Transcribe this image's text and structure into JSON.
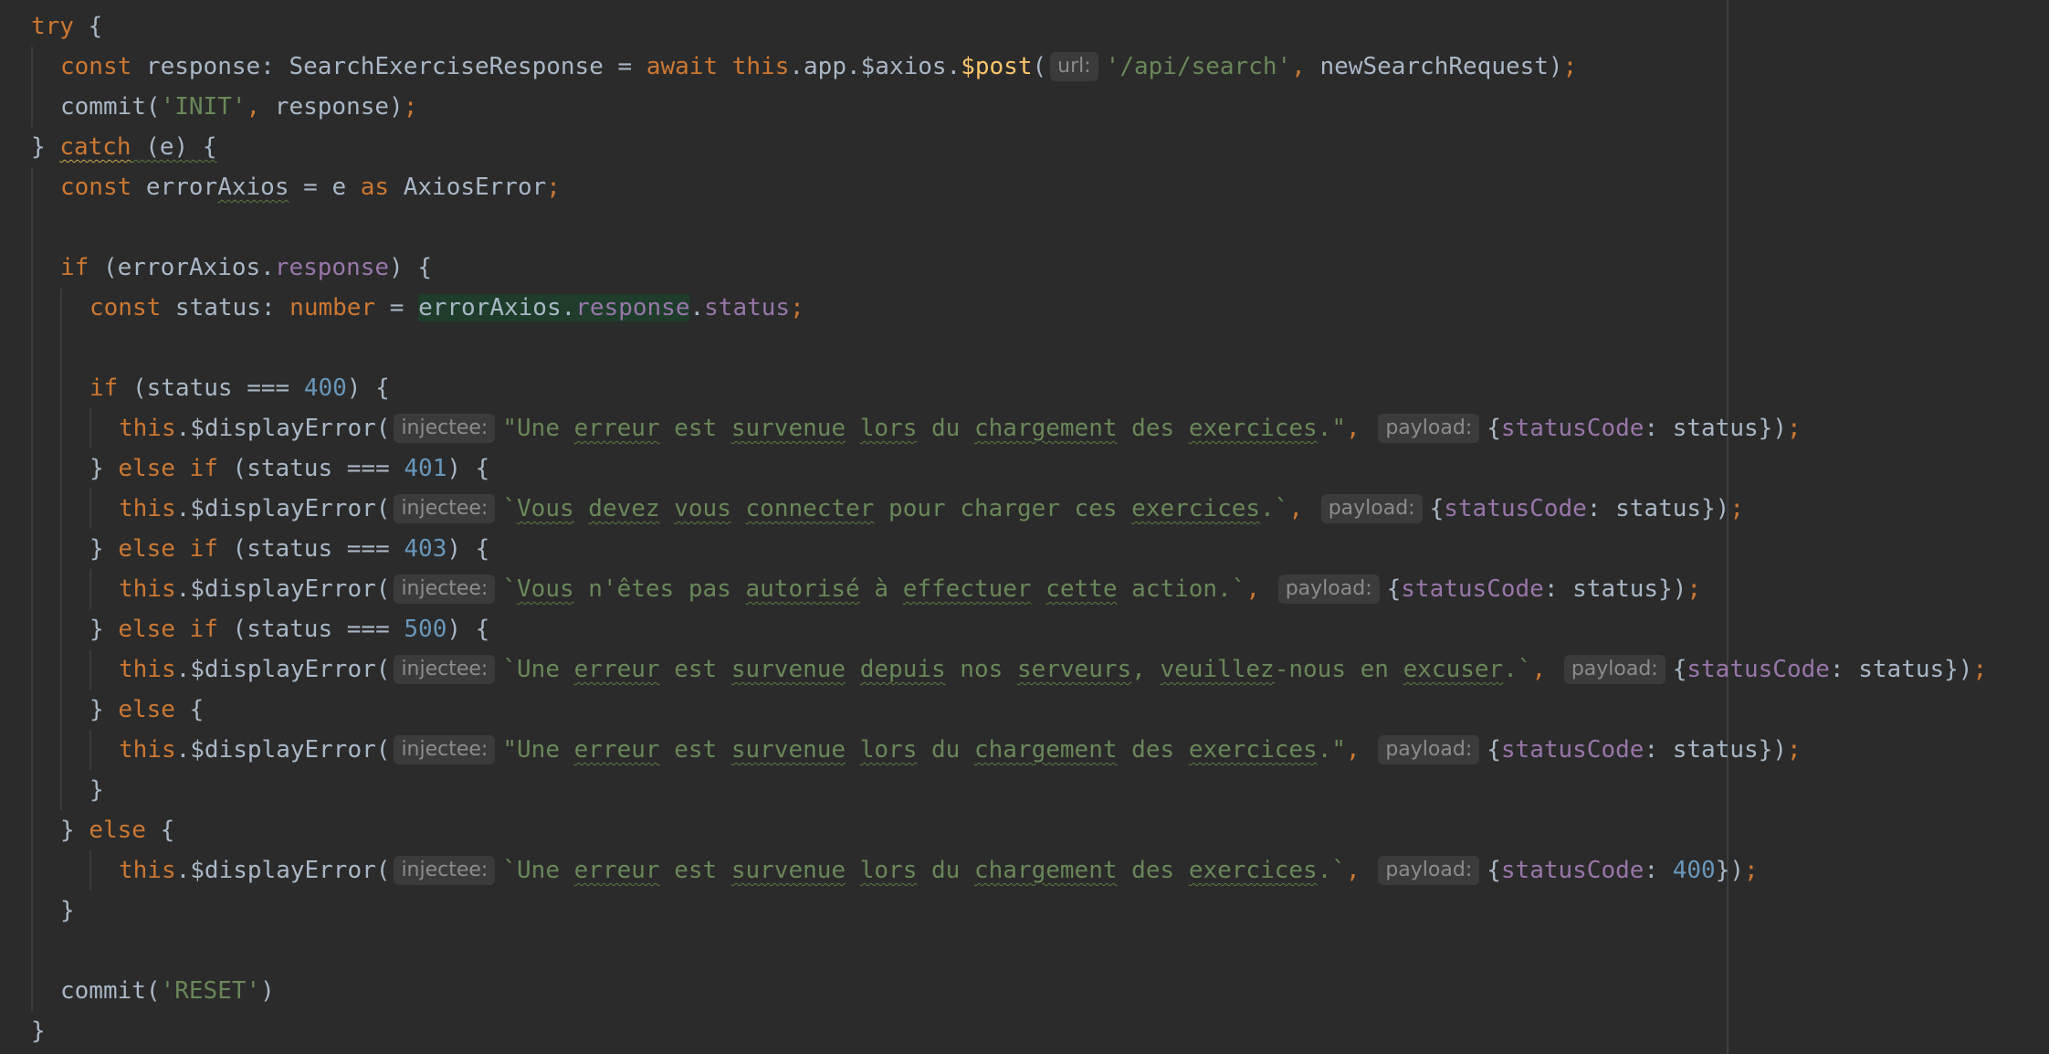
{
  "editor": {
    "language": "TypeScript",
    "colors": {
      "background": "#2b2b2b",
      "keyword": "#cc7832",
      "string": "#6a8759",
      "number": "#6897bb",
      "property": "#9876aa",
      "function": "#ffc66d",
      "text": "#a9b7c6",
      "hint_bg": "#3b3b3b",
      "hint_text": "#8c8c8c",
      "highlight": "#1f3d2b"
    },
    "lines": [
      [
        [
          "kw",
          "try"
        ],
        [
          "plain",
          " {"
        ]
      ],
      [
        [
          "kw",
          "const"
        ],
        [
          "plain",
          " response: SearchExerciseResponse = "
        ],
        [
          "kw",
          "await"
        ],
        [
          "plain",
          " "
        ],
        [
          "kw",
          "this"
        ],
        [
          "plain",
          ".app.$axios."
        ],
        [
          "fn",
          "$post"
        ],
        [
          "plain",
          "("
        ],
        [
          "hint",
          "url:"
        ],
        [
          "str",
          "'/api/search'"
        ],
        [
          "punct",
          ","
        ],
        [
          "plain",
          " newSearchRequest)"
        ],
        [
          "punct",
          ";"
        ]
      ],
      [
        [
          "plain",
          "commit("
        ],
        [
          "str",
          "'INIT'"
        ],
        [
          "punct",
          ","
        ],
        [
          "plain",
          " response)"
        ],
        [
          "punct",
          ";"
        ]
      ],
      [
        [
          "plain",
          "} "
        ],
        [
          "kwtypo",
          "catch"
        ],
        [
          "plaintypo",
          " (e) {"
        ]
      ],
      [
        [
          "kw",
          "const"
        ],
        [
          "plain",
          " error"
        ],
        [
          "plaintypo",
          "Axios"
        ],
        [
          "plain",
          " = e "
        ],
        [
          "kw",
          "as"
        ],
        [
          "plain",
          " AxiosError"
        ],
        [
          "punct",
          ";"
        ]
      ],
      [],
      [
        [
          "kw",
          "if"
        ],
        [
          "plain",
          " (errorAxios."
        ],
        [
          "prop",
          "response"
        ],
        [
          "plain",
          ") {"
        ]
      ],
      [
        [
          "kw",
          "const"
        ],
        [
          "plain",
          " status: "
        ],
        [
          "kw",
          "number"
        ],
        [
          "plain",
          " = "
        ],
        [
          "hlplain",
          "errorAxios."
        ],
        [
          "hlprop",
          "response"
        ],
        [
          "plain",
          "."
        ],
        [
          "prop",
          "status"
        ],
        [
          "punct",
          ";"
        ]
      ],
      [],
      [
        [
          "kw",
          "if"
        ],
        [
          "plain",
          " (status === "
        ],
        [
          "num",
          "400"
        ],
        [
          "plain",
          ") {"
        ]
      ],
      [
        [
          "kw",
          "this"
        ],
        [
          "plain",
          ".$displayError("
        ],
        [
          "hint",
          "injectee:"
        ],
        [
          "str",
          "\"Une "
        ],
        [
          "strtypo",
          "erreur"
        ],
        [
          "str",
          " est "
        ],
        [
          "strtypo",
          "survenue"
        ],
        [
          "str",
          " "
        ],
        [
          "strtypo",
          "lors"
        ],
        [
          "str",
          " du "
        ],
        [
          "strtypo",
          "chargement"
        ],
        [
          "str",
          " des "
        ],
        [
          "strtypo",
          "exercices"
        ],
        [
          "str",
          ".\""
        ],
        [
          "punct",
          ","
        ],
        [
          "plain",
          " "
        ],
        [
          "hint",
          "payload:"
        ],
        [
          "plain",
          "{"
        ],
        [
          "prop",
          "statusCode"
        ],
        [
          "plain",
          ": status})"
        ],
        [
          "punct",
          ";"
        ]
      ],
      [
        [
          "plain",
          "} "
        ],
        [
          "kw",
          "else if"
        ],
        [
          "plain",
          " (status === "
        ],
        [
          "num",
          "401"
        ],
        [
          "plain",
          ") {"
        ]
      ],
      [
        [
          "kw",
          "this"
        ],
        [
          "plain",
          ".$displayError("
        ],
        [
          "hint",
          "injectee:"
        ],
        [
          "str",
          "`"
        ],
        [
          "strtypo",
          "Vous"
        ],
        [
          "str",
          " "
        ],
        [
          "strtypo",
          "devez"
        ],
        [
          "str",
          " "
        ],
        [
          "strtypo",
          "vous"
        ],
        [
          "str",
          " "
        ],
        [
          "strtypo",
          "connecter"
        ],
        [
          "str",
          " pour charger ces "
        ],
        [
          "strtypo",
          "exercices"
        ],
        [
          "str",
          ".`"
        ],
        [
          "punct",
          ","
        ],
        [
          "plain",
          " "
        ],
        [
          "hint",
          "payload:"
        ],
        [
          "plain",
          "{"
        ],
        [
          "prop",
          "statusCode"
        ],
        [
          "plain",
          ": status})"
        ],
        [
          "punct",
          ";"
        ]
      ],
      [
        [
          "plain",
          "} "
        ],
        [
          "kw",
          "else if"
        ],
        [
          "plain",
          " (status === "
        ],
        [
          "num",
          "403"
        ],
        [
          "plain",
          ") {"
        ]
      ],
      [
        [
          "kw",
          "this"
        ],
        [
          "plain",
          ".$displayError("
        ],
        [
          "hint",
          "injectee:"
        ],
        [
          "str",
          "`"
        ],
        [
          "strtypo",
          "Vous"
        ],
        [
          "str",
          " n'êtes pas "
        ],
        [
          "strtypo",
          "autorisé"
        ],
        [
          "str",
          " à "
        ],
        [
          "strtypo",
          "effectuer"
        ],
        [
          "str",
          " "
        ],
        [
          "strtypo",
          "cette"
        ],
        [
          "str",
          " action.`"
        ],
        [
          "punct",
          ","
        ],
        [
          "plain",
          " "
        ],
        [
          "hint",
          "payload:"
        ],
        [
          "plain",
          "{"
        ],
        [
          "prop",
          "statusCode"
        ],
        [
          "plain",
          ": status})"
        ],
        [
          "punct",
          ";"
        ]
      ],
      [
        [
          "plain",
          "} "
        ],
        [
          "kw",
          "else if"
        ],
        [
          "plain",
          " (status === "
        ],
        [
          "num",
          "500"
        ],
        [
          "plain",
          ") {"
        ]
      ],
      [
        [
          "kw",
          "this"
        ],
        [
          "plain",
          ".$displayError("
        ],
        [
          "hint",
          "injectee:"
        ],
        [
          "str",
          "`Une "
        ],
        [
          "strtypo",
          "erreur"
        ],
        [
          "str",
          " est "
        ],
        [
          "strtypo",
          "survenue"
        ],
        [
          "str",
          " "
        ],
        [
          "strtypo",
          "depuis"
        ],
        [
          "str",
          " nos "
        ],
        [
          "strtypo",
          "serveurs"
        ],
        [
          "str",
          ", "
        ],
        [
          "strtypo",
          "veuillez"
        ],
        [
          "str",
          "-nous en "
        ],
        [
          "strtypo",
          "excuser"
        ],
        [
          "str",
          ".`"
        ],
        [
          "punct",
          ","
        ],
        [
          "plain",
          " "
        ],
        [
          "hint",
          "payload:"
        ],
        [
          "plain",
          "{"
        ],
        [
          "prop",
          "statusCode"
        ],
        [
          "plain",
          ": status})"
        ],
        [
          "punct",
          ";"
        ]
      ],
      [
        [
          "plain",
          "} "
        ],
        [
          "kw",
          "else"
        ],
        [
          "plain",
          " {"
        ]
      ],
      [
        [
          "kw",
          "this"
        ],
        [
          "plain",
          ".$displayError("
        ],
        [
          "hint",
          "injectee:"
        ],
        [
          "str",
          "\"Une "
        ],
        [
          "strtypo",
          "erreur"
        ],
        [
          "str",
          " est "
        ],
        [
          "strtypo",
          "survenue"
        ],
        [
          "str",
          " "
        ],
        [
          "strtypo",
          "lors"
        ],
        [
          "str",
          " du "
        ],
        [
          "strtypo",
          "chargement"
        ],
        [
          "str",
          " des "
        ],
        [
          "strtypo",
          "exercices"
        ],
        [
          "str",
          ".\""
        ],
        [
          "punct",
          ","
        ],
        [
          "plain",
          " "
        ],
        [
          "hint",
          "payload:"
        ],
        [
          "plain",
          "{"
        ],
        [
          "prop",
          "statusCode"
        ],
        [
          "plain",
          ": status})"
        ],
        [
          "punct",
          ";"
        ]
      ],
      [
        [
          "plain",
          "}"
        ]
      ],
      [
        [
          "plain",
          "} "
        ],
        [
          "kw",
          "else"
        ],
        [
          "plain",
          " {"
        ]
      ],
      [
        [
          "kw",
          "this"
        ],
        [
          "plain",
          ".$displayError("
        ],
        [
          "hint",
          "injectee:"
        ],
        [
          "str",
          "`Une "
        ],
        [
          "strtypo",
          "erreur"
        ],
        [
          "str",
          " est "
        ],
        [
          "strtypo",
          "survenue"
        ],
        [
          "str",
          " "
        ],
        [
          "strtypo",
          "lors"
        ],
        [
          "str",
          " du "
        ],
        [
          "strtypo",
          "chargement"
        ],
        [
          "str",
          " des "
        ],
        [
          "strtypo",
          "exercices"
        ],
        [
          "str",
          ".`"
        ],
        [
          "punct",
          ","
        ],
        [
          "plain",
          " "
        ],
        [
          "hint",
          "payload:"
        ],
        [
          "plain",
          "{"
        ],
        [
          "prop",
          "statusCode"
        ],
        [
          "plain",
          ": "
        ],
        [
          "num",
          "400"
        ],
        [
          "plain",
          "})"
        ],
        [
          "punct",
          ";"
        ]
      ],
      [
        [
          "plain",
          "}"
        ]
      ],
      [],
      [
        [
          "plain",
          "commit("
        ],
        [
          "str",
          "'RESET'"
        ],
        [
          "plain",
          ")"
        ]
      ],
      [
        [
          "plain",
          "}"
        ]
      ]
    ]
  }
}
